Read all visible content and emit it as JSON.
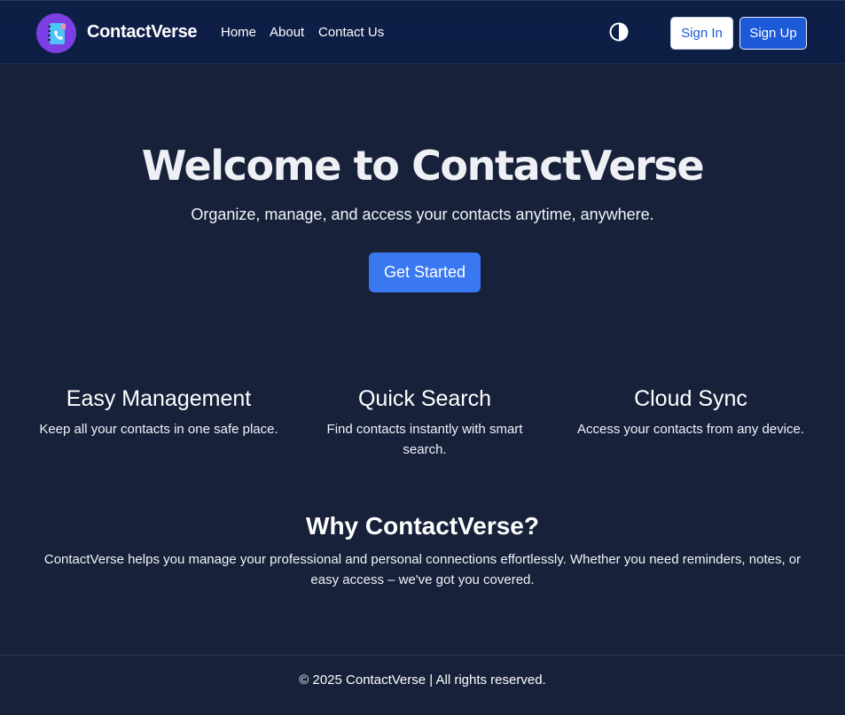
{
  "header": {
    "brand": "ContactVerse",
    "nav": [
      {
        "label": "Home"
      },
      {
        "label": "About"
      },
      {
        "label": "Contact Us"
      }
    ],
    "theme_toggle_icon": "contrast-icon",
    "sign_in_label": "Sign In",
    "sign_up_label": "Sign Up"
  },
  "hero": {
    "title": "Welcome to ContactVerse",
    "subtitle": "Organize, manage, and access your contacts anytime, anywhere.",
    "cta_label": "Get Started"
  },
  "features": [
    {
      "title": "Easy Management",
      "text": "Keep all your contacts in one safe place."
    },
    {
      "title": "Quick Search",
      "text": "Find contacts instantly with smart search."
    },
    {
      "title": "Cloud Sync",
      "text": "Access your contacts from any device."
    }
  ],
  "why": {
    "title": "Why ContactVerse?",
    "text": "ContactVerse helps you manage your professional and personal connections effortlessly. Whether you need reminders, notes, or easy access – we've got you covered."
  },
  "footer": {
    "text": "© 2025 ContactVerse | All rights reserved."
  },
  "colors": {
    "background": "#17213a",
    "navbar": "#0e1f46",
    "primary": "#1c5ad8",
    "cta": "#3a78f2",
    "logo_bg": "#7b3fe4"
  }
}
